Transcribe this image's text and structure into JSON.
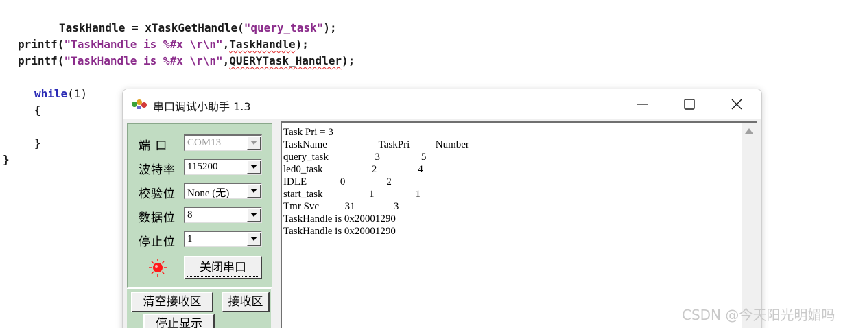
{
  "editor": {
    "lines": [
      {
        "pre": "TaskHandle = xTaskGetHandle(",
        "str": "\"query_task\"",
        "post": ");"
      },
      {
        "pre": "printf(",
        "str": "\"TaskHandle is %#x \\r\\n\"",
        "mid": ",",
        "sq": "TaskHandle",
        "post": ");"
      },
      {
        "pre": "printf(",
        "str": "\"TaskHandle is %#x \\r\\n\"",
        "mid": ",",
        "sq": "QUERYTask_Handler",
        "post": ");"
      }
    ],
    "while_kw": "while",
    "while_rest": "(1)",
    "brace_open": "{",
    "brace_close": "}",
    "brace_close_outer": "}"
  },
  "window": {
    "title": "串口调试小助手 1.3",
    "icons": {
      "app": "app-logo-icon",
      "minimize": "minimize-icon",
      "maximize": "maximize-icon",
      "close": "close-icon"
    }
  },
  "settings": {
    "port": {
      "label": "端 口",
      "value": "COM13"
    },
    "baud": {
      "label": "波特率",
      "value": "115200"
    },
    "parity": {
      "label": "校验位",
      "value": "None (无)"
    },
    "databits": {
      "label": "数据位",
      "value": "8"
    },
    "stopbits": {
      "label": "停止位",
      "value": "1"
    },
    "close_port_label": "关闭串口",
    "led_color": "#ff1a1a"
  },
  "buttons": {
    "clear_recv": "清空接收区",
    "recv": "接收区",
    "stop_display": "停止显示"
  },
  "receive": {
    "lines": [
      "Task Pri = 3",
      "TaskName                    TaskPri          Number",
      "query_task                  3                5",
      "led0_task                   2                4",
      "IDLE             0                2",
      "start_task                  1                1",
      "Tmr Svc          31               3",
      "TaskHandle is 0x20001290",
      "TaskHandle is 0x20001290"
    ]
  },
  "watermark": "CSDN @今天阳光明媚吗"
}
